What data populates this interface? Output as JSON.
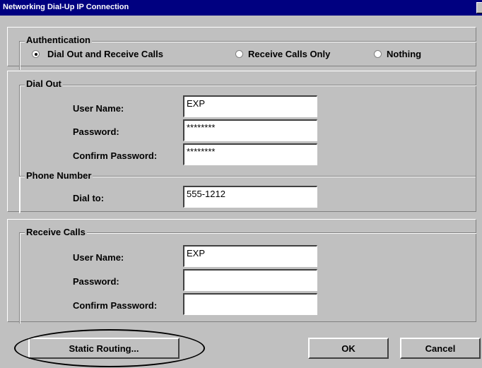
{
  "window": {
    "title": "Networking Dial-Up IP Connection"
  },
  "authentication": {
    "legend": "Authentication",
    "options": [
      {
        "label": "Dial Out and Receive Calls",
        "selected": true
      },
      {
        "label": "Receive Calls Only",
        "selected": false
      },
      {
        "label": "Nothing",
        "selected": false
      }
    ]
  },
  "dial_out": {
    "legend": "Dial Out",
    "user_name_label": "User Name:",
    "user_name_value": "EXP",
    "password_label": "Password:",
    "password_value": "********",
    "confirm_password_label": "Confirm Password:",
    "confirm_password_value": "********"
  },
  "phone_number": {
    "legend": "Phone Number",
    "dial_to_label": "Dial to:",
    "dial_to_value": "555-1212"
  },
  "receive_calls": {
    "legend": "Receive Calls",
    "user_name_label": "User Name:",
    "user_name_value": "EXP",
    "password_label": "Password:",
    "password_value": "",
    "confirm_password_label": "Confirm Password:",
    "confirm_password_value": ""
  },
  "buttons": {
    "static_routing": "Static Routing...",
    "ok": "OK",
    "cancel": "Cancel"
  },
  "colors": {
    "titlebar": "#000080",
    "dialog_face": "#c0c0c0"
  },
  "icons": {
    "close": "close-icon"
  }
}
